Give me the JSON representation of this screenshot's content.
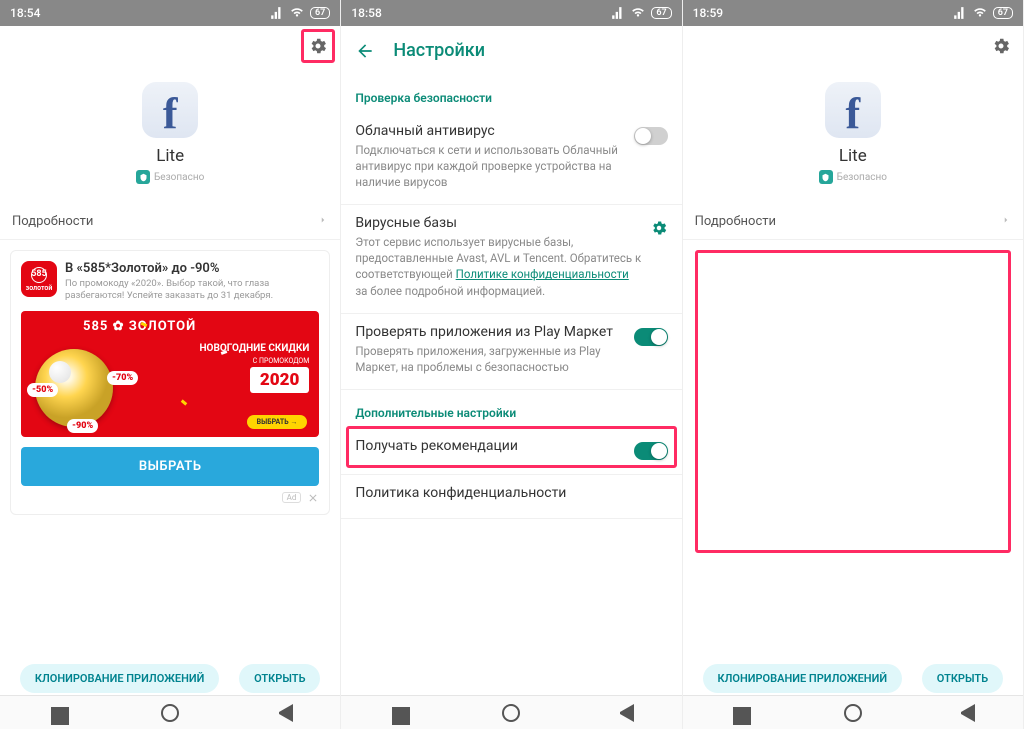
{
  "screen1": {
    "time": "18:54",
    "battery": "67",
    "app_name": "Lite",
    "safe_label": "Безопасно",
    "details_label": "Подробности",
    "ad": {
      "title": "В «585*Золотой» до -90%",
      "subtitle": "По промокоду «2020». Выбор такой, что глаза разбегаются! Успейте заказать до 31 декабря.",
      "brand": "585 ✿ ЗОЛОТОЙ",
      "headline": "НОВОГОДНИЕ СКИДКИ",
      "promo_small": "С ПРОМОКОДОМ",
      "promo_code": "2020",
      "cta_inner": "ВЫБРАТЬ →",
      "sale50": "-50%",
      "sale70": "-70%",
      "sale90": "-90%",
      "button": "ВЫБРАТЬ",
      "ad_badge": "Ad"
    },
    "clone_btn": "КЛОНИРОВАНИЕ ПРИЛОЖЕНИЙ",
    "open_btn": "ОТКРЫТЬ"
  },
  "screen2": {
    "time": "18:58",
    "battery": "67",
    "title": "Настройки",
    "section1": "Проверка безопасности",
    "row1": {
      "title": "Облачный антивирус",
      "desc": "Подключаться к сети и использовать Облачный антивирус при каждой проверке устройства на наличие вирусов"
    },
    "row2": {
      "title": "Вирусные базы",
      "desc_pre": "Этот сервис использует вирусные базы, предоставленные Avast, AVL и Tencent. Обратитесь к соответствующей ",
      "link": "Политике конфиденциальности",
      "desc_post": " за более подробной информацией."
    },
    "row3": {
      "title": "Проверять приложения из Play Маркет",
      "desc": "Проверять приложения, загруженные из Play Маркет, на проблемы с безопасностью"
    },
    "section2": "Дополнительные настройки",
    "row4": {
      "title": "Получать рекомендации"
    },
    "row5": {
      "title": "Политика конфиденциальности"
    }
  },
  "screen3": {
    "time": "18:59",
    "battery": "67",
    "app_name": "Lite",
    "safe_label": "Безопасно",
    "details_label": "Подробности",
    "clone_btn": "КЛОНИРОВАНИЕ ПРИЛОЖЕНИЙ",
    "open_btn": "ОТКРЫТЬ"
  }
}
